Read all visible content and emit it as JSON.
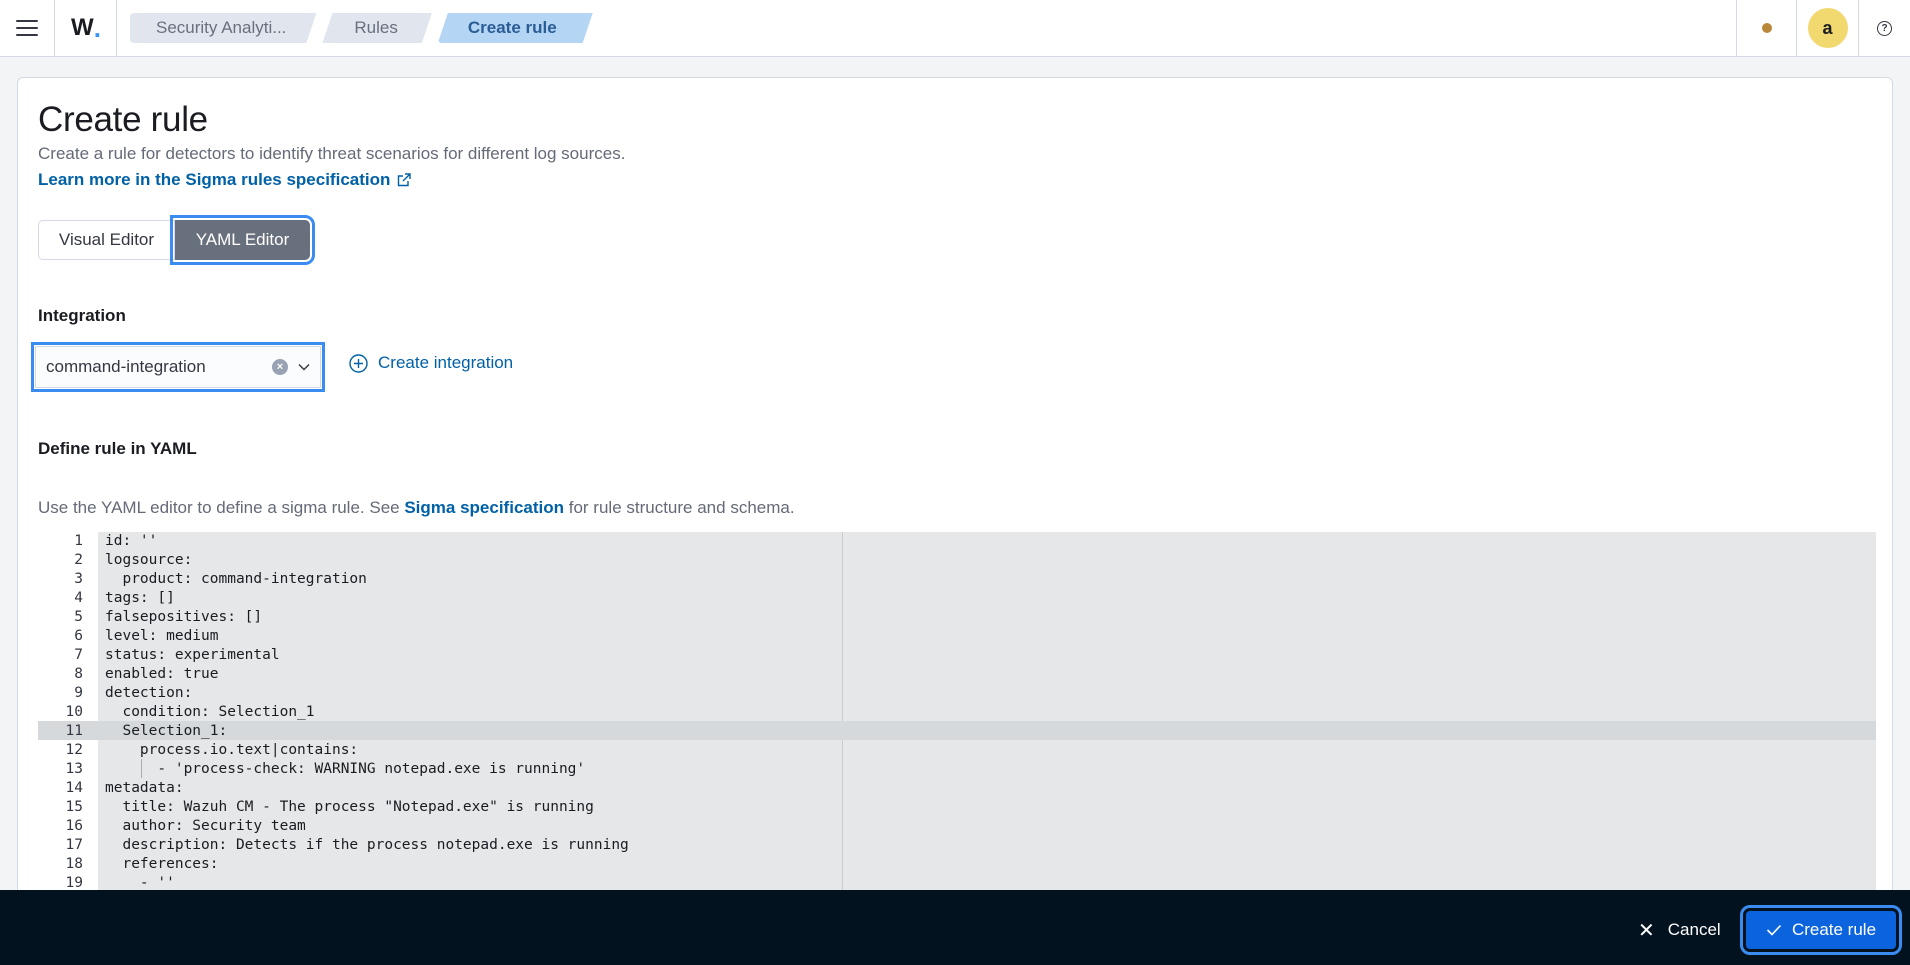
{
  "header": {
    "logo_text": "W",
    "breadcrumbs": [
      "Security Analyti...",
      "Rules",
      "Create rule"
    ],
    "avatar_letter": "a",
    "help_glyph": "?",
    "status_color": "#b9873a",
    "accent_color": "#3a8cf0"
  },
  "page": {
    "title": "Create rule",
    "description": "Create a rule for detectors to identify threat scenarios for different log sources.",
    "learn_link": "Learn more in the Sigma rules specification"
  },
  "editor_toggle": {
    "visual_label": "Visual Editor",
    "yaml_label": "YAML Editor",
    "selected": "YAML Editor"
  },
  "integration": {
    "label": "Integration",
    "value": "command-integration",
    "create_label": "Create integration"
  },
  "yaml": {
    "section_title": "Define rule in YAML",
    "help_prefix": "Use the YAML editor to define a sigma rule. See ",
    "help_link": "Sigma specification",
    "help_suffix": " for rule structure and schema.",
    "active_line": 11,
    "lines": [
      "id: ''",
      "logsource:",
      "  product: command-integration",
      "tags: []",
      "falsepositives: []",
      "level: medium",
      "status: experimental",
      "enabled: true",
      "detection:",
      "  condition: Selection_1",
      "  Selection_1:",
      "    process.io.text|contains:",
      "      - 'process-check: WARNING notepad.exe is running'",
      "metadata:",
      "  title: Wazuh CM - The process \"Notepad.exe\" is running",
      "  author: Security team",
      "  description: Detects if the process notepad.exe is running",
      "  references:",
      "    - ''"
    ]
  },
  "footer": {
    "cancel_label": "Cancel",
    "create_label": "Create rule"
  }
}
